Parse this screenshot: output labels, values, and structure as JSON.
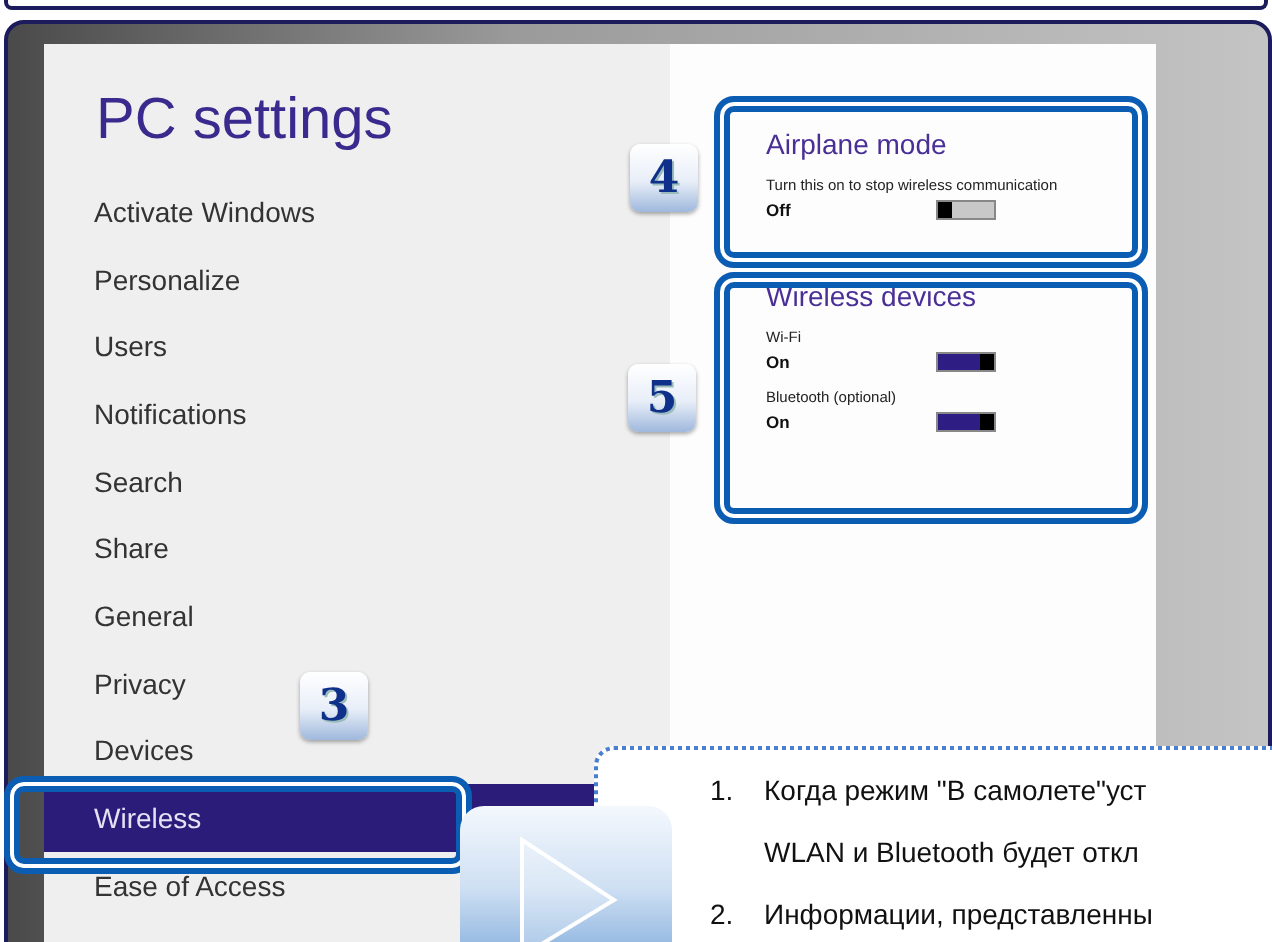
{
  "window": {
    "title": "PC settings"
  },
  "nav_items": [
    {
      "label": "Activate Windows",
      "selected": false
    },
    {
      "label": "Personalize",
      "selected": false
    },
    {
      "label": "Users",
      "selected": false
    },
    {
      "label": "Notifications",
      "selected": false
    },
    {
      "label": "Search",
      "selected": false
    },
    {
      "label": "Share",
      "selected": false
    },
    {
      "label": "General",
      "selected": false
    },
    {
      "label": "Privacy",
      "selected": false
    },
    {
      "label": "Devices",
      "selected": false
    },
    {
      "label": "Wireless",
      "selected": true
    },
    {
      "label": "Ease of Access",
      "selected": false
    }
  ],
  "sections": [
    {
      "title": "Airplane mode",
      "settings": [
        {
          "label": "Turn this on to stop wireless communication",
          "state": "Off",
          "on": false
        }
      ]
    },
    {
      "title": "Wireless devices",
      "settings": [
        {
          "label": "Wi-Fi",
          "state": "On",
          "on": true
        },
        {
          "label": "Bluetooth (optional)",
          "state": "On",
          "on": true
        }
      ]
    }
  ],
  "step_badges": [
    "4",
    "5",
    "3"
  ],
  "callout": [
    {
      "number": "1.",
      "text": "Когда режим \"В самолете\"уст"
    },
    {
      "text": "WLAN и Bluetooth будет откл"
    },
    {
      "number": "2.",
      "text": "Информации, представленны"
    }
  ]
}
